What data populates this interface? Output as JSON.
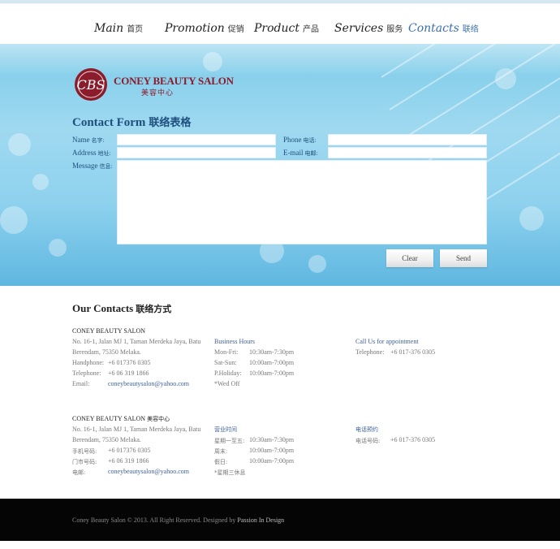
{
  "nav": {
    "items": [
      {
        "en": "Main",
        "zh": "首页"
      },
      {
        "en": "Promotion",
        "zh": "促销"
      },
      {
        "en": "Product",
        "zh": "产品"
      },
      {
        "en": "Services",
        "zh": "服务"
      },
      {
        "en": "Contacts",
        "zh": "联络",
        "active": true
      }
    ]
  },
  "logo": {
    "initials": "CBS",
    "name": "CONEY BEAUTY SALON",
    "sub": "美容中心"
  },
  "form": {
    "title": "Contact Form",
    "title_zh": "联络表格",
    "name_label": "Name",
    "name_label_zh": "名字:",
    "phone_label": "Phone",
    "phone_label_zh": "电话:",
    "address_label": "Address",
    "address_label_zh": "地址:",
    "email_label": "E-mail",
    "email_label_zh": "电邮:",
    "message_label": "Message",
    "message_label_zh": "信息:",
    "clear_label": "Clear",
    "send_label": "Send"
  },
  "contacts": {
    "title": "Our Contacts",
    "title_zh": "联络方式",
    "en": {
      "company": "CONEY BEAUTY SALON",
      "address_1": "No. 16-1, Jalan MJ 1, Taman Merdeka Jaya, Batu",
      "address_2": "Berendam, 75350 Melaka.",
      "handphone_label": "Handphone:",
      "handphone": "+6 017376 0305",
      "telephone_label": "Telephone:",
      "telephone": "+6 06 319 1866",
      "email_label": "Email:",
      "email": "coneybeautysalon@yahoo.com",
      "hours_title": "Business Hours",
      "hours": [
        {
          "day": "Mon-Fri:",
          "time": "10:30am-7:30pm"
        },
        {
          "day": "Sat-Sun:",
          "time": "10:00am-7:00pm"
        },
        {
          "day": "P.Holiday:",
          "time": "10:00am-7:00pm"
        }
      ],
      "hours_note": "*Wed Off",
      "call_title": "Call Us for appointment",
      "call_label": "Telephone:",
      "call_number": "+6 017-376 0305"
    },
    "zh": {
      "company": "CONEY BEAUTY SALON",
      "company_zh": "美容中心",
      "address_1": "No. 16-1, Jalan MJ 1, Taman Merdeka Jaya, Batu",
      "address_2": "Berendam, 75350 Melaka.",
      "handphone_label": "手机号码:",
      "handphone": "+6 017376 0305",
      "telephone_label": "门市号码:",
      "telephone": "+6 06 319 1866",
      "email_label": "电邮:",
      "email": "coneybeautysalon@yahoo.com",
      "hours_title": "营业时间",
      "hours": [
        {
          "day": "星期一至五:",
          "time": "10:30am-7:30pm"
        },
        {
          "day": "周末:",
          "time": "10:00am-7:00pm"
        },
        {
          "day": "假日:",
          "time": "10:00am-7:00pm"
        }
      ],
      "hours_note": "*星期三休息",
      "call_title": "电话预约",
      "call_label": "电话号码:",
      "call_number": "+6 017-376 0305"
    }
  },
  "footer": {
    "text": "Coney Beauty Salon © 2013. All Right Reserved. Designed by",
    "designer": "Passion In Design"
  },
  "colors": {
    "brand": "#8a1c2b",
    "heading_blue": "#1e4f7d",
    "link_blue": "#3a5fa0",
    "footer_bg": "#050505"
  }
}
